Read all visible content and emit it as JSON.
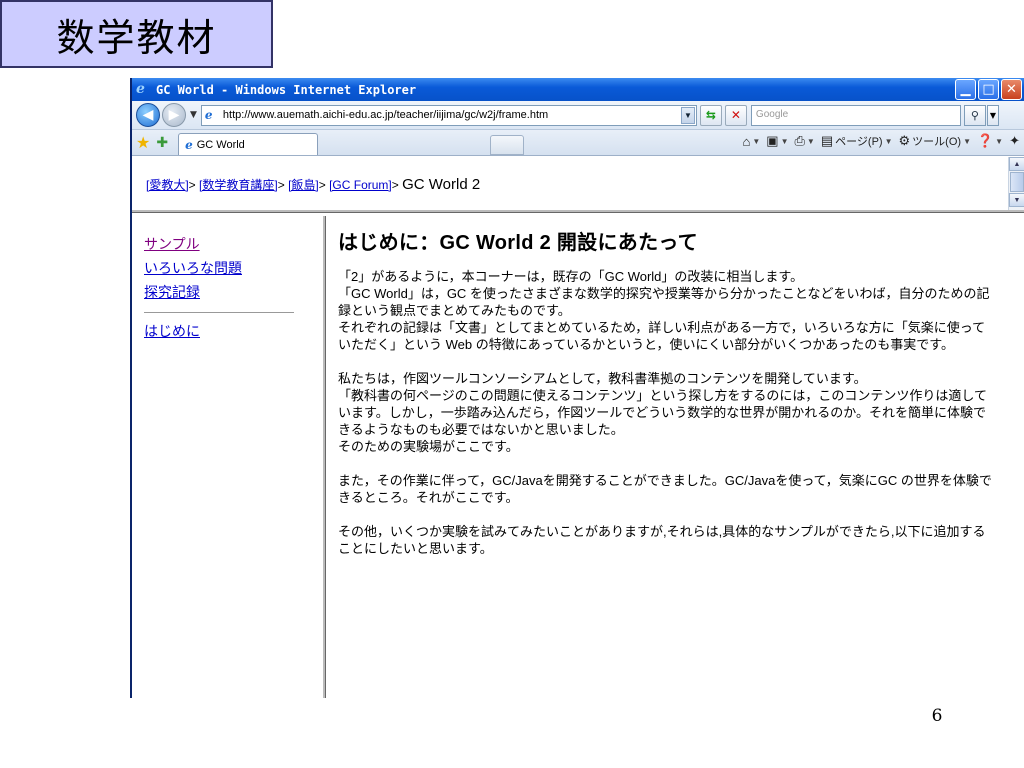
{
  "slide": {
    "title": "数学教材",
    "page_number": "6"
  },
  "browser": {
    "window_title": "GC World - Windows Internet Explorer",
    "address_url": "http://www.auemath.aichi-edu.ac.jp/teacher/iijima/gc/w2j/frame.htm",
    "search_placeholder": "Google",
    "tab_label": "GC World",
    "commands": {
      "page": "ページ(P)",
      "tools": "ツール(O)"
    }
  },
  "breadcrumb": {
    "items": [
      "[愛教大]",
      "[数学教育講座]",
      "[飯島]",
      "[GC Forum]"
    ],
    "separator": ">",
    "current": "GC World 2"
  },
  "left_nav": {
    "items": [
      "サンプル",
      "いろいろな問題",
      "探究記録"
    ],
    "intro": "はじめに"
  },
  "main": {
    "heading": "はじめに：GC World 2 開設にあたって",
    "paragraphs": [
      "「2」があるように，本コーナーは，既存の「GC World」の改装に相当します。\n「GC World」は，GC を使ったさまざまな数学的探究や授業等から分かったことなどをいわば，自分のための記録という観点でまとめてみたものです。\nそれぞれの記録は「文書」としてまとめているため，詳しい利点がある一方で，いろいろな方に「気楽に使っていただく」という Web の特徴にあっているかというと，使いにくい部分がいくつかあったのも事実です。",
      "私たちは，作図ツールコンソーシアムとして，教科書準拠のコンテンツを開発しています。\n「教科書の何ページのこの問題に使えるコンテンツ」という探し方をするのには，このコンテンツ作りは適しています。しかし，一歩踏み込んだら，作図ツールでどういう数学的な世界が開かれるのか。それを簡単に体験できるようなものも必要ではないかと思いました。\nそのための実験場がここです。",
      "また，その作業に伴って，GC/Javaを開発することができました。GC/Javaを使って，気楽にGC の世界を体験できるところ。それがここです。",
      "その他，いくつか実験を試みてみたいことがありますが,それらは,具体的なサンプルができたら,以下に追加することにしたいと思います。"
    ]
  }
}
